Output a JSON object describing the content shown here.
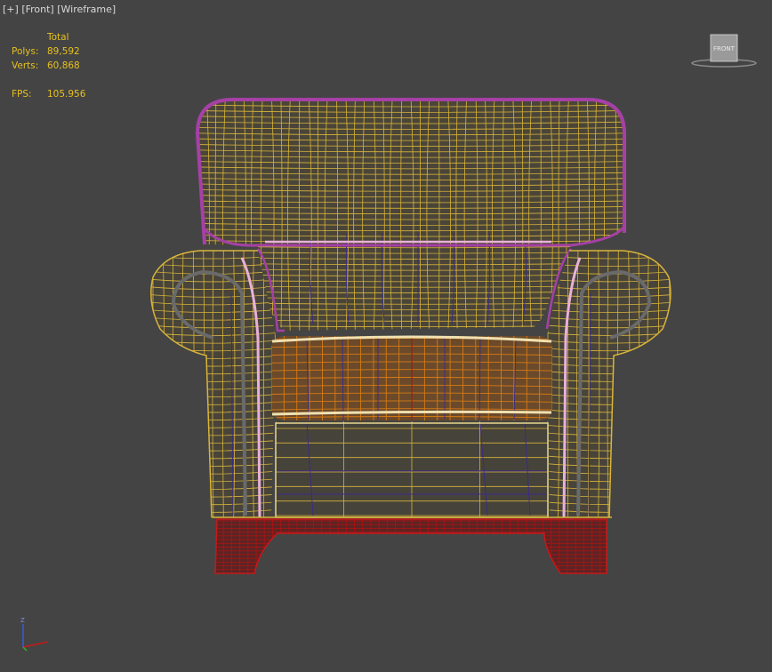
{
  "viewport": {
    "label_plus": "[+]",
    "label_view": "[Front]",
    "label_shading": "[Wireframe]"
  },
  "stats": {
    "header": "Total",
    "polys_label": "Polys:",
    "polys_value": "89,592",
    "verts_label": "Verts:",
    "verts_value": "60,868",
    "fps_label": "FPS:",
    "fps_value": "105.956"
  },
  "viewcube": {
    "face_label": "FRONT"
  },
  "axis": {
    "z_label": "Z"
  },
  "colors": {
    "background": "#444444",
    "stats_text": "#e6c01e",
    "wire_body": "#d8b43a",
    "wire_outline": "#a640a6",
    "wire_seat": "#d87a14",
    "wire_base": "#a81414",
    "wire_inner": "#3a2a8c",
    "wire_trim": "#e8b0d8",
    "wire_piping": "#6a6a6a"
  }
}
